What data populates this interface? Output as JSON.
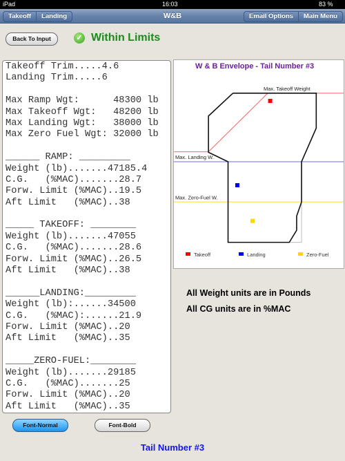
{
  "status_bar": {
    "device": "iPad",
    "time": "16:03",
    "battery": "83 %"
  },
  "nav": {
    "title": "W&B",
    "left_buttons": [
      "Takeoff",
      "Landing"
    ],
    "right_buttons": [
      "Email Options",
      "Main Menu"
    ]
  },
  "back_button": "Back To Input",
  "limits_status": "Within Limits",
  "report_lines": [
    "Takeoff Trim.....4.6",
    "Landing Trim.....6",
    "",
    "Max Ramp Wgt:      48300 lb",
    "Max Takeoff Wgt:   48200 lb",
    "Max Landing Wgt:   38000 lb",
    "Max Zero Fuel Wgt: 32000 lb",
    "",
    "______ RAMP: _________",
    "Weight (lb).......47185.4",
    "C.G.   (%MAC).......28.7",
    "Forw. Limit (%MAC)..19.5",
    "Aft Limit   (%MAC)..38",
    "",
    "_____ TAKEOFF: ________",
    "Weight (lb).......47055",
    "C.G.   (%MAC).......28.6",
    "Forw. Limit (%MAC)..26.5",
    "Aft Limit   (%MAC)..38",
    "",
    "______LANDING:_________",
    "Weight (lb):......34500",
    "C.G.   (%MAC):......21.9",
    "Forw. Limit (%MAC)..20",
    "Aft Limit   (%MAC)..35",
    "",
    "_____ZERO-FUEL:________",
    "Weight (lb).......29185",
    "C.G.   (%MAC).......25",
    "Forw. Limit (%MAC)..20",
    "Aft Limit   (%MAC)..35"
  ],
  "chart_data": {
    "type": "scatter",
    "title": "W & B Envelope - Tail Number #3",
    "xlabel": "",
    "ylabel": "",
    "xlim": [
      9,
      43.7
    ],
    "ylim": [
      22150,
      52900
    ],
    "grid": false,
    "legend": "bottom",
    "envelope": {
      "cg": [
        21,
        38,
        38,
        35,
        35,
        34,
        34,
        32.5,
        20,
        20,
        16,
        16,
        21
      ],
      "weight": [
        48200,
        48200,
        43000,
        38000,
        32000,
        29900,
        27800,
        26000,
        26000,
        38000,
        39400,
        44800,
        48200
      ]
    },
    "limit_lines": [
      {
        "label": "Max. Takeoff Weight",
        "weight": 48200,
        "color": "#ff6060"
      },
      {
        "label": "Max. Landing W.",
        "weight": 38000,
        "color": "#6a6aff"
      },
      {
        "label": "Max. Zero-Fuel W.",
        "weight": 32000,
        "color": "#ffe680"
      }
    ],
    "takeoff_diagonal": {
      "cg": [
        9,
        16,
        28.1
      ],
      "weight": [
        39480,
        39480,
        48200
      ]
    },
    "series": [
      {
        "name": "Takeoff",
        "cg": 28.6,
        "weight": 47055,
        "color": "#ff0000"
      },
      {
        "name": "Landing",
        "cg": 21.9,
        "weight": 34500,
        "color": "#0000ff"
      },
      {
        "name": "Zero-Fuel",
        "cg": 25,
        "weight": 29185,
        "color": "#ffd700"
      }
    ]
  },
  "info": {
    "weight_units": "All Weight units are in Pounds",
    "cg_units": "All CG units are in %MAC"
  },
  "font_buttons": {
    "normal": "Font-Normal",
    "bold": "Font-Bold"
  },
  "tail_number": "Tail Number #3"
}
